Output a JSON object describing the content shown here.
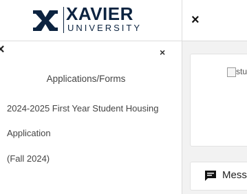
{
  "brand": {
    "name": "XAVIER",
    "subtitle": "UNIVERSITY",
    "colors": {
      "navy": "#0c2340"
    }
  },
  "sidebar": {
    "close_left_glyph": "×",
    "close_right_glyph": "×",
    "title": "Applications/Forms",
    "items": [
      "2024-2025 First Year Student Housing",
      "Application",
      "(Fall 2024)"
    ]
  },
  "main": {
    "close_glyph": "×",
    "card": {
      "image_alt": "stu"
    },
    "messages": {
      "label": "Mess",
      "icon": "message-icon"
    }
  }
}
